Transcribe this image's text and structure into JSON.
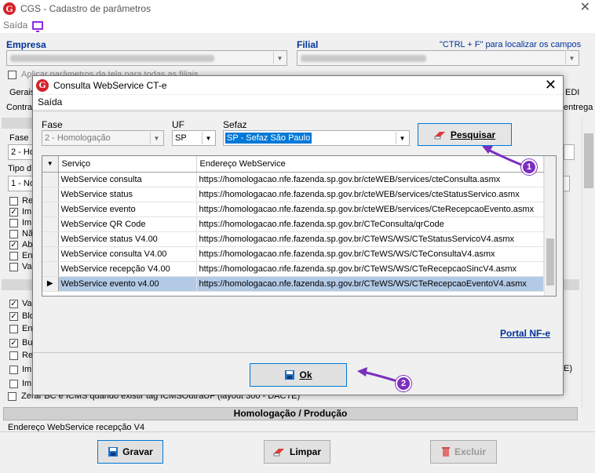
{
  "main": {
    "title": "CGS - Cadastro de parâmetros",
    "menu_saida": "Saída",
    "empresa_label": "Empresa",
    "filial_label": "Filial",
    "hint": "\"CTRL + F\" para localizar os campos",
    "aplicar_label": "Aplicar parâmetros da tela para todas as filiais",
    "tab_gerais": "Gerais",
    "tab_contrat": "Contrat",
    "tab_edi": "EDI",
    "tab_entrega": "entrega",
    "fase_label": "Fase",
    "fase_value": "2 - Ho",
    "tipo_label": "Tipo d",
    "tipo_value": "1 - No",
    "left_items": [
      "Re",
      "Im",
      "Im",
      "Nã",
      "Ab",
      "En",
      "Va",
      "Va",
      "Blo",
      "En",
      "Bu",
      "Re",
      "Im",
      "Im"
    ],
    "zerar_label": "Zerar BC e ICMS quando existir tag ICMSOutraUF (layout 300 - DACTE)",
    "right_fragment": "E)",
    "section_title": "Homologação / Produção",
    "endereco_label": "Endereço WebService recepção V4",
    "buttons": {
      "gravar": "Gravar",
      "limpar": "Limpar",
      "excluir": "Excluir"
    }
  },
  "dialog": {
    "title": "Consulta WebService CT-e",
    "menu_saida": "Saída",
    "fase_label": "Fase",
    "fase_value": "2 - Homologação",
    "uf_label": "UF",
    "uf_value": "SP",
    "sefaz_label": "Sefaz",
    "sefaz_value": "SP - Sefaz São Paulo",
    "pesquisar_label": "Pesquisar",
    "columns": [
      "Serviço",
      "Endereço WebService"
    ],
    "rows": [
      [
        "WebService consulta",
        "https://homologacao.nfe.fazenda.sp.gov.br/cteWEB/services/cteConsulta.asmx"
      ],
      [
        "WebService status",
        "https://homologacao.nfe.fazenda.sp.gov.br/cteWEB/services/cteStatusServico.asmx"
      ],
      [
        "WebService evento",
        "https://homologacao.nfe.fazenda.sp.gov.br/cteWEB/services/CteRecepcaoEvento.asmx"
      ],
      [
        "WebService QR Code",
        "https://homologacao.nfe.fazenda.sp.gov.br/CTeConsulta/qrCode"
      ],
      [
        "WebService status V4.00",
        "https://homologacao.nfe.fazenda.sp.gov.br/CTeWS/WS/CTeStatusServicoV4.asmx"
      ],
      [
        "WebService consulta V4.00",
        "https://homologacao.nfe.fazenda.sp.gov.br/CTeWS/WS/CTeConsultaV4.asmx"
      ],
      [
        "WebService recepção V4.00",
        "https://homologacao.nfe.fazenda.sp.gov.br/CTeWS/WS/CTeRecepcaoSincV4.asmx"
      ],
      [
        "WebService evento v4.00",
        "https://homologacao.nfe.fazenda.sp.gov.br/CTeWS/WS/CTeRecepcaoEventoV4.asmx"
      ]
    ],
    "selected_row": 7,
    "portal_link": "Portal NF-e",
    "ok_label": "Ok"
  },
  "annotations": {
    "step1": "1",
    "step2": "2",
    "color": "#7b2fbe"
  },
  "colors": {
    "accent_blue": "#003399",
    "selection": "#b3cae6",
    "logo_red": "#d4232b"
  },
  "icons": [
    "cgs-logo-icon",
    "monitor-icon",
    "eraser-icon",
    "save-icon",
    "trash-icon",
    "close-icon"
  ]
}
